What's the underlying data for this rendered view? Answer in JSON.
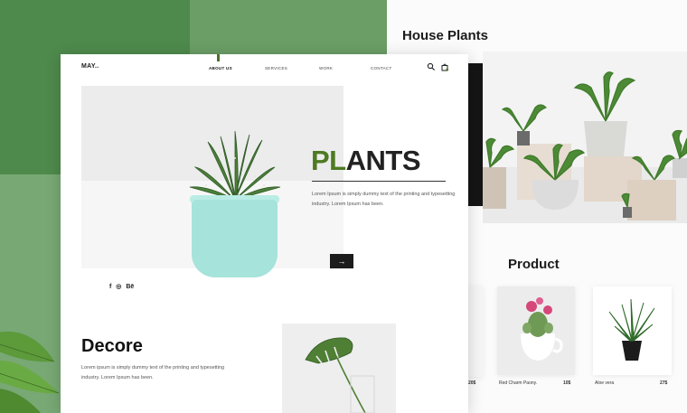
{
  "house_section": {
    "title": "House Plants"
  },
  "product_section": {
    "title": "Product",
    "items": [
      {
        "name": "",
        "price": "20$"
      },
      {
        "name": "Red Charm Paony.",
        "price": "10$"
      },
      {
        "name": "Aloe vera",
        "price": "27$"
      }
    ]
  },
  "site": {
    "logo": "MAY..",
    "nav": [
      "ABOUT US",
      "SERVICES",
      "WORK",
      "CONTACT"
    ],
    "hero": {
      "title_highlight": "PL",
      "title_rest": "ANTS",
      "description": "Lorem Ipsum is simply dummy text of the printing and typesetting industry. Lorem Ipsum has been.",
      "social": [
        "f",
        "◎",
        "Bē"
      ],
      "arrow": "→"
    },
    "decore": {
      "title": "Decore",
      "description": "Lorem ipsum is simply dummy text of the printing and typesetting industry. Lorem Ipsum has been."
    }
  },
  "colors": {
    "brand_green": "#4e7a22",
    "bg_green_dark": "#4e8a4c",
    "bg_green_mid": "#6a9e66",
    "pot_mint": "#a6e3da"
  },
  "icons": [
    "search-icon",
    "shopping-bag-icon",
    "facebook-icon",
    "dribbble-icon",
    "behance-icon",
    "arrow-right-icon"
  ]
}
